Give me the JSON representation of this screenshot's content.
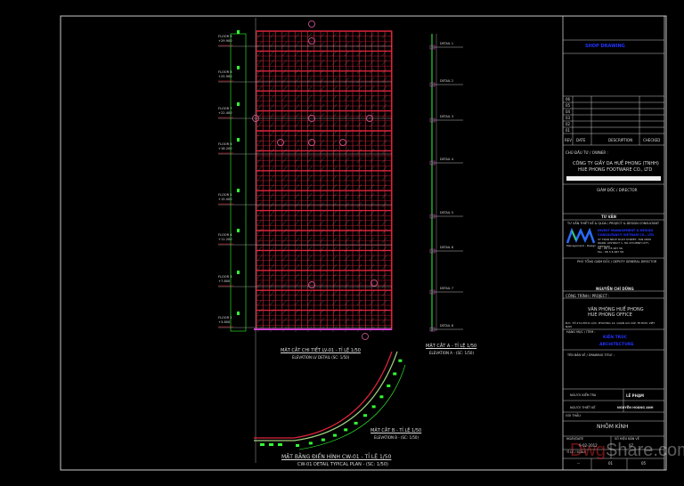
{
  "colors": {
    "background": "#000000",
    "frame": "#c8c8c8",
    "curtain_wall": "#e0243c",
    "mullion": "#33ff33",
    "text_accent": "#2233ff"
  },
  "elevation": {
    "levels": [
      {
        "name": "FLOOR 9",
        "elev": "+29.900"
      },
      {
        "name": "FLOOR 8",
        "elev": "+25.900"
      },
      {
        "name": "FLOOR 7",
        "elev": "+22.400"
      },
      {
        "name": "FLOOR 6",
        "elev": "+18.200"
      },
      {
        "name": "FLOOR 5",
        "elev": "+15.000"
      },
      {
        "name": "FLOOR 4",
        "elev": "+11.200"
      },
      {
        "name": "FLOOR 3",
        "elev": "+7.800"
      },
      {
        "name": "FLOOR 2",
        "elev": "+3.800"
      }
    ],
    "title": "MẶT CẮT CHI TIẾT LV-01 - TỈ LỆ 1/50",
    "subtitle": "ELEVATION LV DETAIL (SC: 1/50)"
  },
  "section_a": {
    "title": "MẶT CẮT A - TỈ LỆ 1/50",
    "subtitle": "ELEVATION A - (SC: 1/50)",
    "details": [
      "DETAIL 1",
      "DETAIL 2",
      "DETAIL 3",
      "DETAIL 4",
      "DETAIL 5",
      "DETAIL 6",
      "DETAIL 7",
      "DETAIL 8"
    ]
  },
  "section_b": {
    "title": "MẶT CẮT B - TỈ LỆ 1/50",
    "subtitle": "ELEVATION B - (SC: 1/50)"
  },
  "plan": {
    "title": "MẶT BẰNG ĐIỂN HÌNH  CW-01 - TỈ LỆ  1/50",
    "subtitle": "CW-01 DETAIL TYPICAL PLAN - (SC: 1/50)"
  },
  "title_block": {
    "stamp": "SHOP DRAWING",
    "rev_rows": [
      "06",
      "05",
      "04",
      "03",
      "02",
      "01"
    ],
    "rev_headers": [
      "REV",
      "DATE",
      "DESCRIPTION",
      "CHECKED"
    ],
    "owner_label": "CHỦ ĐẦU TƯ / OWNER :",
    "owner_vn": "CÔNG TY GIẦY DA HUẾ PHONG (TNHH)",
    "owner_en": "HUE PHONG FOOTWARE CO., LTD",
    "director_label": "GIÁM ĐỐC / DIRECTOR",
    "consultant_head": "TƯ VẤN",
    "consultant_label": "TƯ VẤN THIẾT KẾ & QLDA / PROJECT & DESIGN CONSULTANT",
    "consultant_name": "INVEST MANAGEMENT & DESIGN CONSULTANCY VIETNAM CO., LTD",
    "consultant_addr": "37 TRAN NHAT DUAT STREET, TAN DINH WARD, DISTRICT 1, HO CHI MINH CITY, VIETNAM",
    "consultant_tel": "Tel : 08 3 8 487 56",
    "consultant_fax": "Fax : 08 3 8 487 58",
    "logo_caption": "Management - Design",
    "deputy_label": "PHÓ TỔNG GIÁM ĐỐC / DEPUTY GENERAL DIRECTOR",
    "deputy_name": "NGUYỄN CHÍ DŨNG",
    "project_label": "CÔNG TRÌNH / PROJECT :",
    "project_vn": "VĂN PHÒNG HUẾ PHONG",
    "project_en": "HUE PHONG OFFICE",
    "project_addr": "Đ/C: TỔ 27A PHÚC LỘC, PHƯỜNG 12, QUẬN GÒ VẤP, TP.HCM, VIỆT NAM",
    "item_label": "HẠNG MỤC / ITEM :",
    "item_vn": "KIẾN TRÚC",
    "item_en": "ARCHITECTURE",
    "drawing_title_label": "TÊN BẢN VẼ / DRAWING TITLE :",
    "checker_label": "NGƯỜI KIỂM TRA",
    "checker": "LÊ PHẠM",
    "drawer_label": "NGƯỜI THIẾT KẾ",
    "drawer": "NGUYỄN HOÀNG ANH",
    "package_label": "GÓI THẦU",
    "package": "NHÔM KÍNH",
    "date_label": "NGÀY/DATE",
    "date": "9-02-2012",
    "drawing_no_label": "SỐ HIỆU BẢN VẼ",
    "drawing_no": "07",
    "scale_label": "TỈ LỆ / SCALE",
    "bottom_cells": [
      "--",
      "01",
      "05"
    ]
  },
  "watermark": {
    "prefix": "Dwg",
    "suffix": "Share.com"
  }
}
